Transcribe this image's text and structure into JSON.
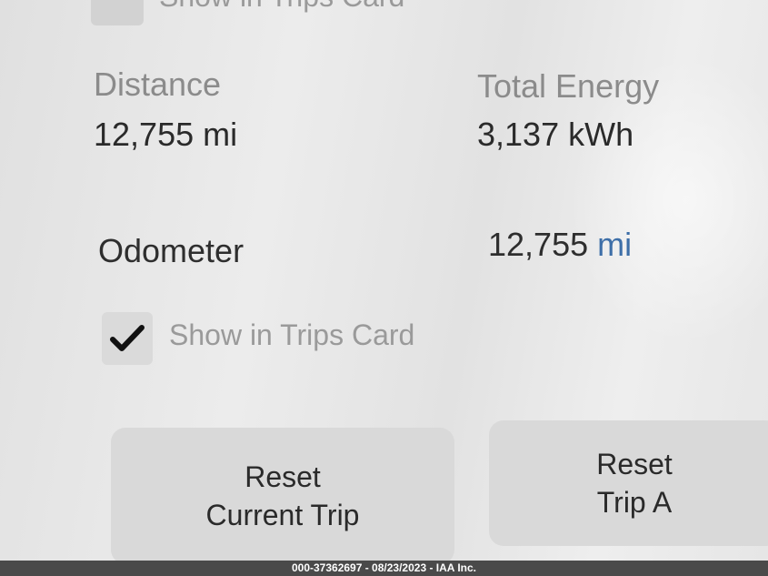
{
  "top_row": {
    "show_in_trips_label": "Show in Trips Card"
  },
  "distance": {
    "label": "Distance",
    "value": "12,755 mi"
  },
  "total_energy": {
    "label": "Total Energy",
    "value": "3,137 kWh"
  },
  "odometer": {
    "label": "Odometer",
    "value": "12,755",
    "unit": "mi",
    "unit_color": "#3e6fa8"
  },
  "show_in_trips": {
    "label": "Show in Trips Card",
    "checked": true,
    "icon": "checkmark-icon"
  },
  "buttons": {
    "reset_current_trip": {
      "line1": "Reset",
      "line2": "Current Trip"
    },
    "reset_trip_a": {
      "line1": "Reset",
      "line2": "Trip A"
    }
  },
  "footer": {
    "watermark": "000-37362697 - 08/23/2023 - IAA Inc."
  }
}
